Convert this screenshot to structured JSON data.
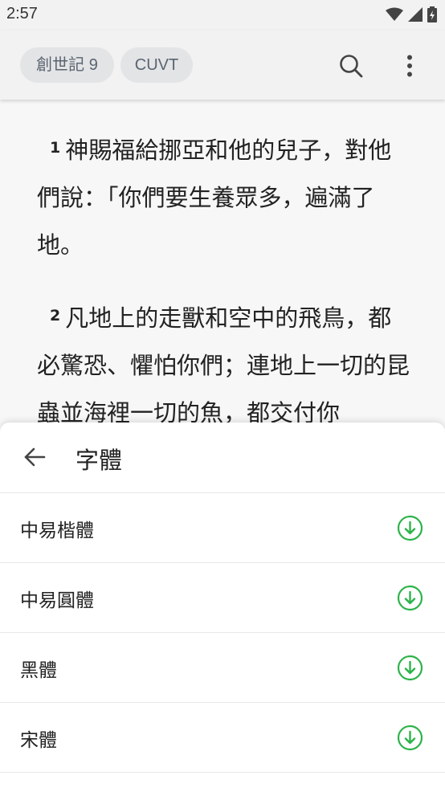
{
  "status_bar": {
    "time": "2:57"
  },
  "toolbar": {
    "book_chip": "創世記 9",
    "version_chip": "CUVT",
    "search_icon": "search-icon",
    "more_icon": "more-vert-icon"
  },
  "reader": {
    "verses": [
      {
        "number": "1",
        "text": "神賜福給挪亞和他的兒子，對他們說：「你們要生養眾多，遍滿了地。"
      },
      {
        "number": "2",
        "text": "凡地上的走獸和空中的飛鳥，都必驚恐、懼怕你們；連地上一切的昆蟲並海裡一切的魚，都交付你"
      }
    ]
  },
  "sheet": {
    "title": "字體",
    "back_icon": "arrow-left-icon",
    "fonts": [
      {
        "name": "中易楷體",
        "icon": "download-icon"
      },
      {
        "name": "中易圓體",
        "icon": "download-icon"
      },
      {
        "name": "黑體",
        "icon": "download-icon"
      },
      {
        "name": "宋體",
        "icon": "download-icon"
      }
    ]
  },
  "colors": {
    "accent_green": "#2db34a",
    "chip_bg": "#e3e4e6",
    "chip_text": "#5a6470",
    "text": "#222222"
  }
}
